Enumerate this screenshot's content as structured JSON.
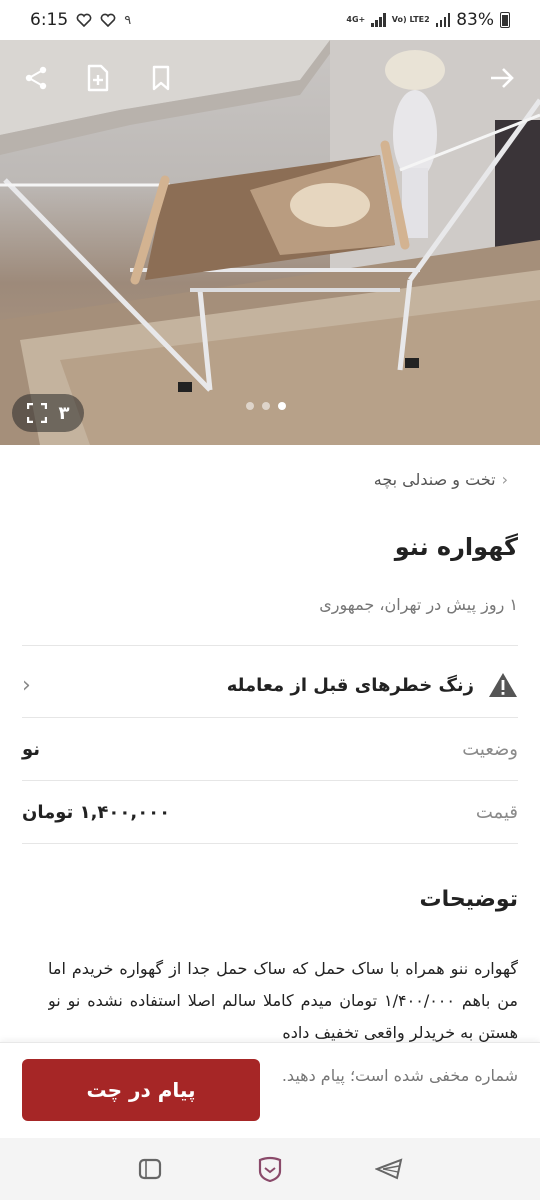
{
  "status_bar": {
    "time": "6:15",
    "notification_count": "۹",
    "network_label": "4G+",
    "lte_label": "Vo) LTE2",
    "battery": "83%"
  },
  "hero": {
    "photo_count": "۳",
    "dots_total": 3,
    "dots_active": 3
  },
  "breadcrumb": {
    "label": "تخت و صندلی بچه"
  },
  "listing": {
    "title": "گهواره ننو",
    "subtitle": "۱ روز پیش در تهران، جمهوری"
  },
  "warning": {
    "label": "زنگ خطرهای قبل از معامله"
  },
  "details": [
    {
      "key": "وضعیت",
      "value": "نو"
    },
    {
      "key": "قیمت",
      "value": "۱,۴۰۰,۰۰۰ تومان"
    }
  ],
  "description": {
    "heading": "توضیحات",
    "text": "گهواره ننو  همراه با ساک حمل که ساک حمل جدا از گهواره خریدم  اما من باهم ۱/۴۰۰/۰۰۰ تومان میدم کاملا سالم اصلا استفاده نشده نو نو هستن  به خریدلر واقعی  تخفیف داده"
  },
  "action_bar": {
    "note": "شماره مخفی شده است؛ پیام دهید.",
    "chat_button_label": "پیام در چت"
  },
  "colors": {
    "accent": "#a62626",
    "text_primary": "#222222",
    "text_secondary": "#8a8a8a"
  },
  "icons": [
    "share-icon",
    "add-note-icon",
    "bookmark-icon",
    "arrow-forward-icon",
    "fullscreen-icon",
    "warning-icon",
    "chevron-left-icon",
    "recent-apps-icon",
    "home-icon",
    "back-icon"
  ]
}
